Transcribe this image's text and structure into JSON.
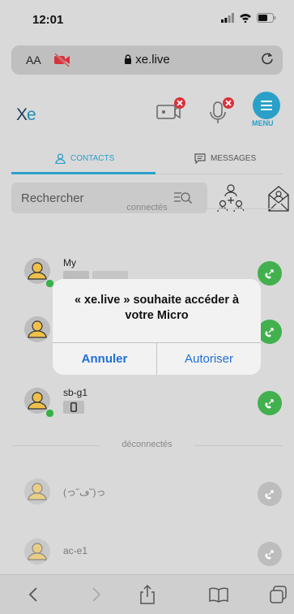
{
  "status_bar": {
    "time": "12:01",
    "icons": [
      "signal-icon",
      "wifi-icon",
      "battery-icon"
    ]
  },
  "url_bar": {
    "text_size_label": "AA",
    "domain": "xe.live",
    "icons": [
      "camera-off-icon",
      "lock-icon",
      "reload-icon"
    ]
  },
  "header": {
    "logo_x": "X",
    "logo_e": "e",
    "menu_label": "MENU",
    "icons": [
      "camera-off-icon",
      "mic-off-icon",
      "menu-icon"
    ]
  },
  "tabs": [
    {
      "label": "CONTACTS",
      "active": true,
      "icon": "user-icon"
    },
    {
      "label": "MESSAGES",
      "active": false,
      "icon": "chat-icon"
    }
  ],
  "search": {
    "placeholder": "Rechercher",
    "icon": "search-filter-icon"
  },
  "sections": {
    "connected": "connectés",
    "disconnected": "déconnectés"
  },
  "contacts_connected": [
    {
      "name": "My"
    },
    {
      "name": ""
    },
    {
      "name": "sb-g1"
    }
  ],
  "contacts_disconnected": [
    {
      "name": "(っ˘ڡ˘)っ"
    },
    {
      "name": "ac-e1"
    }
  ],
  "dialog": {
    "title_line1": "« xe.live » souhaite accéder à",
    "title_line2": "votre Micro",
    "cancel": "Annuler",
    "allow": "Autoriser"
  },
  "toolbar": {
    "icons": [
      "back-icon",
      "forward-icon",
      "share-icon",
      "bookmarks-icon",
      "tabs-icon"
    ]
  },
  "colors": {
    "accent": "#2aa0c9",
    "call_green": "#43b04e",
    "dialog_button": "#1e6fd9",
    "alert_red": "#d8323c"
  }
}
